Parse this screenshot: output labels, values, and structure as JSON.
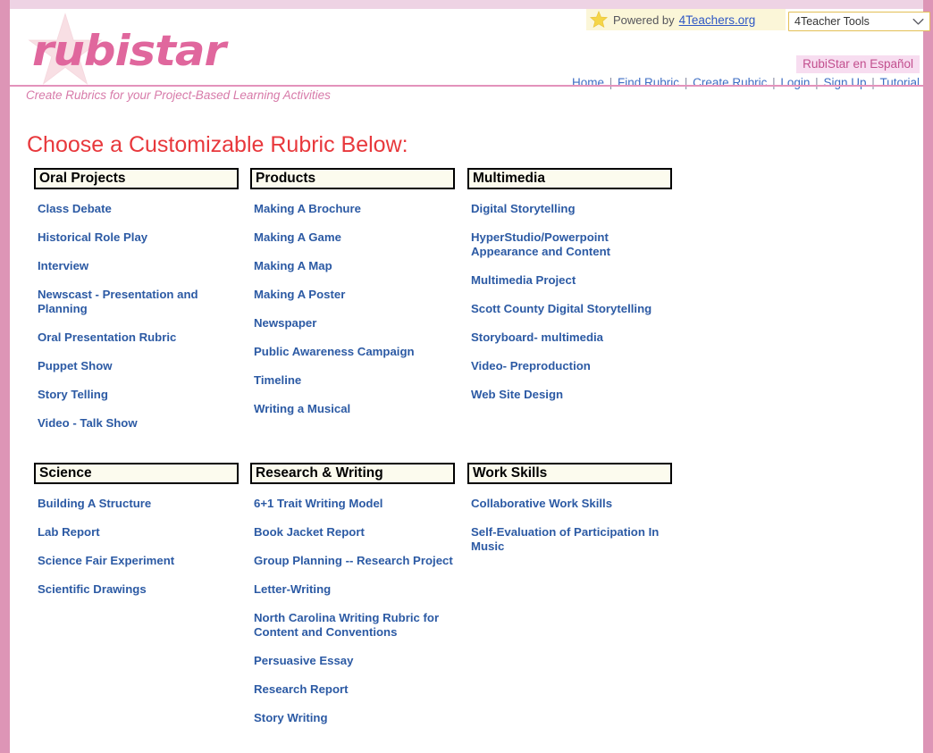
{
  "site": {
    "logo_text": "rubistar",
    "tagline": "Create Rubrics for your Project-Based Learning Activities"
  },
  "header": {
    "powered_by_label": "Powered by",
    "powered_by_brand": "4Teachers.org",
    "star_icon": "star-icon",
    "tools_select": {
      "selected": "4Teacher Tools",
      "chevron_icon": "chevron-down-icon"
    },
    "espanol_label": "RubiStar en Español",
    "nav": [
      "Home",
      "Find Rubric",
      "Create Rubric",
      "Login",
      "Sign Up",
      "Tutorial"
    ],
    "nav_separator": "|"
  },
  "main": {
    "heading": "Choose a Customizable Rubric Below:",
    "categories": [
      {
        "title": "Oral Projects",
        "items": [
          "Class Debate",
          "Historical Role Play",
          "Interview",
          "Newscast - Presentation and Planning",
          "Oral Presentation Rubric",
          "Puppet Show",
          "Story Telling",
          "Video - Talk Show"
        ]
      },
      {
        "title": "Products",
        "items": [
          "Making A Brochure",
          "Making A Game",
          "Making A Map",
          "Making A Poster",
          "Newspaper",
          "Public Awareness Campaign",
          "Timeline",
          "Writing a Musical"
        ]
      },
      {
        "title": "Multimedia",
        "items": [
          "Digital Storytelling",
          "HyperStudio/Powerpoint Appearance and Content",
          "Multimedia Project",
          "Scott County Digital Storytelling",
          "Storyboard- multimedia",
          "Video- Preproduction",
          "Web Site Design"
        ]
      },
      {
        "title": "Science",
        "items": [
          "Building A Structure",
          "Lab Report",
          "Science Fair Experiment",
          "Scientific Drawings"
        ]
      },
      {
        "title": "Research & Writing",
        "items": [
          "6+1 Trait Writing Model",
          "Book Jacket Report",
          "Group Planning -- Research Project",
          "Letter-Writing",
          "North Carolina Writing Rubric for Content and Conventions",
          "Persuasive Essay",
          "Research Report",
          "Story Writing"
        ]
      },
      {
        "title": "Work Skills",
        "items": [
          "Collaborative Work Skills",
          "Self-Evaluation of Participation In Music"
        ]
      }
    ]
  },
  "colors": {
    "pink_border": "#dd95b6",
    "top_band": "#eed3e4",
    "divider": "#e392bb",
    "logo_pink": "#e0679d",
    "heading_red": "#e8383c",
    "link_blue": "#2c5aa4",
    "nav_blue": "#3f6fc4",
    "espanol_bg": "#f7ddf0",
    "espanol_text": "#c24f8e",
    "powered_bg": "#fbf6d8",
    "select_border": "#e3bf56",
    "cat_head_bg": "#fcfbee"
  }
}
